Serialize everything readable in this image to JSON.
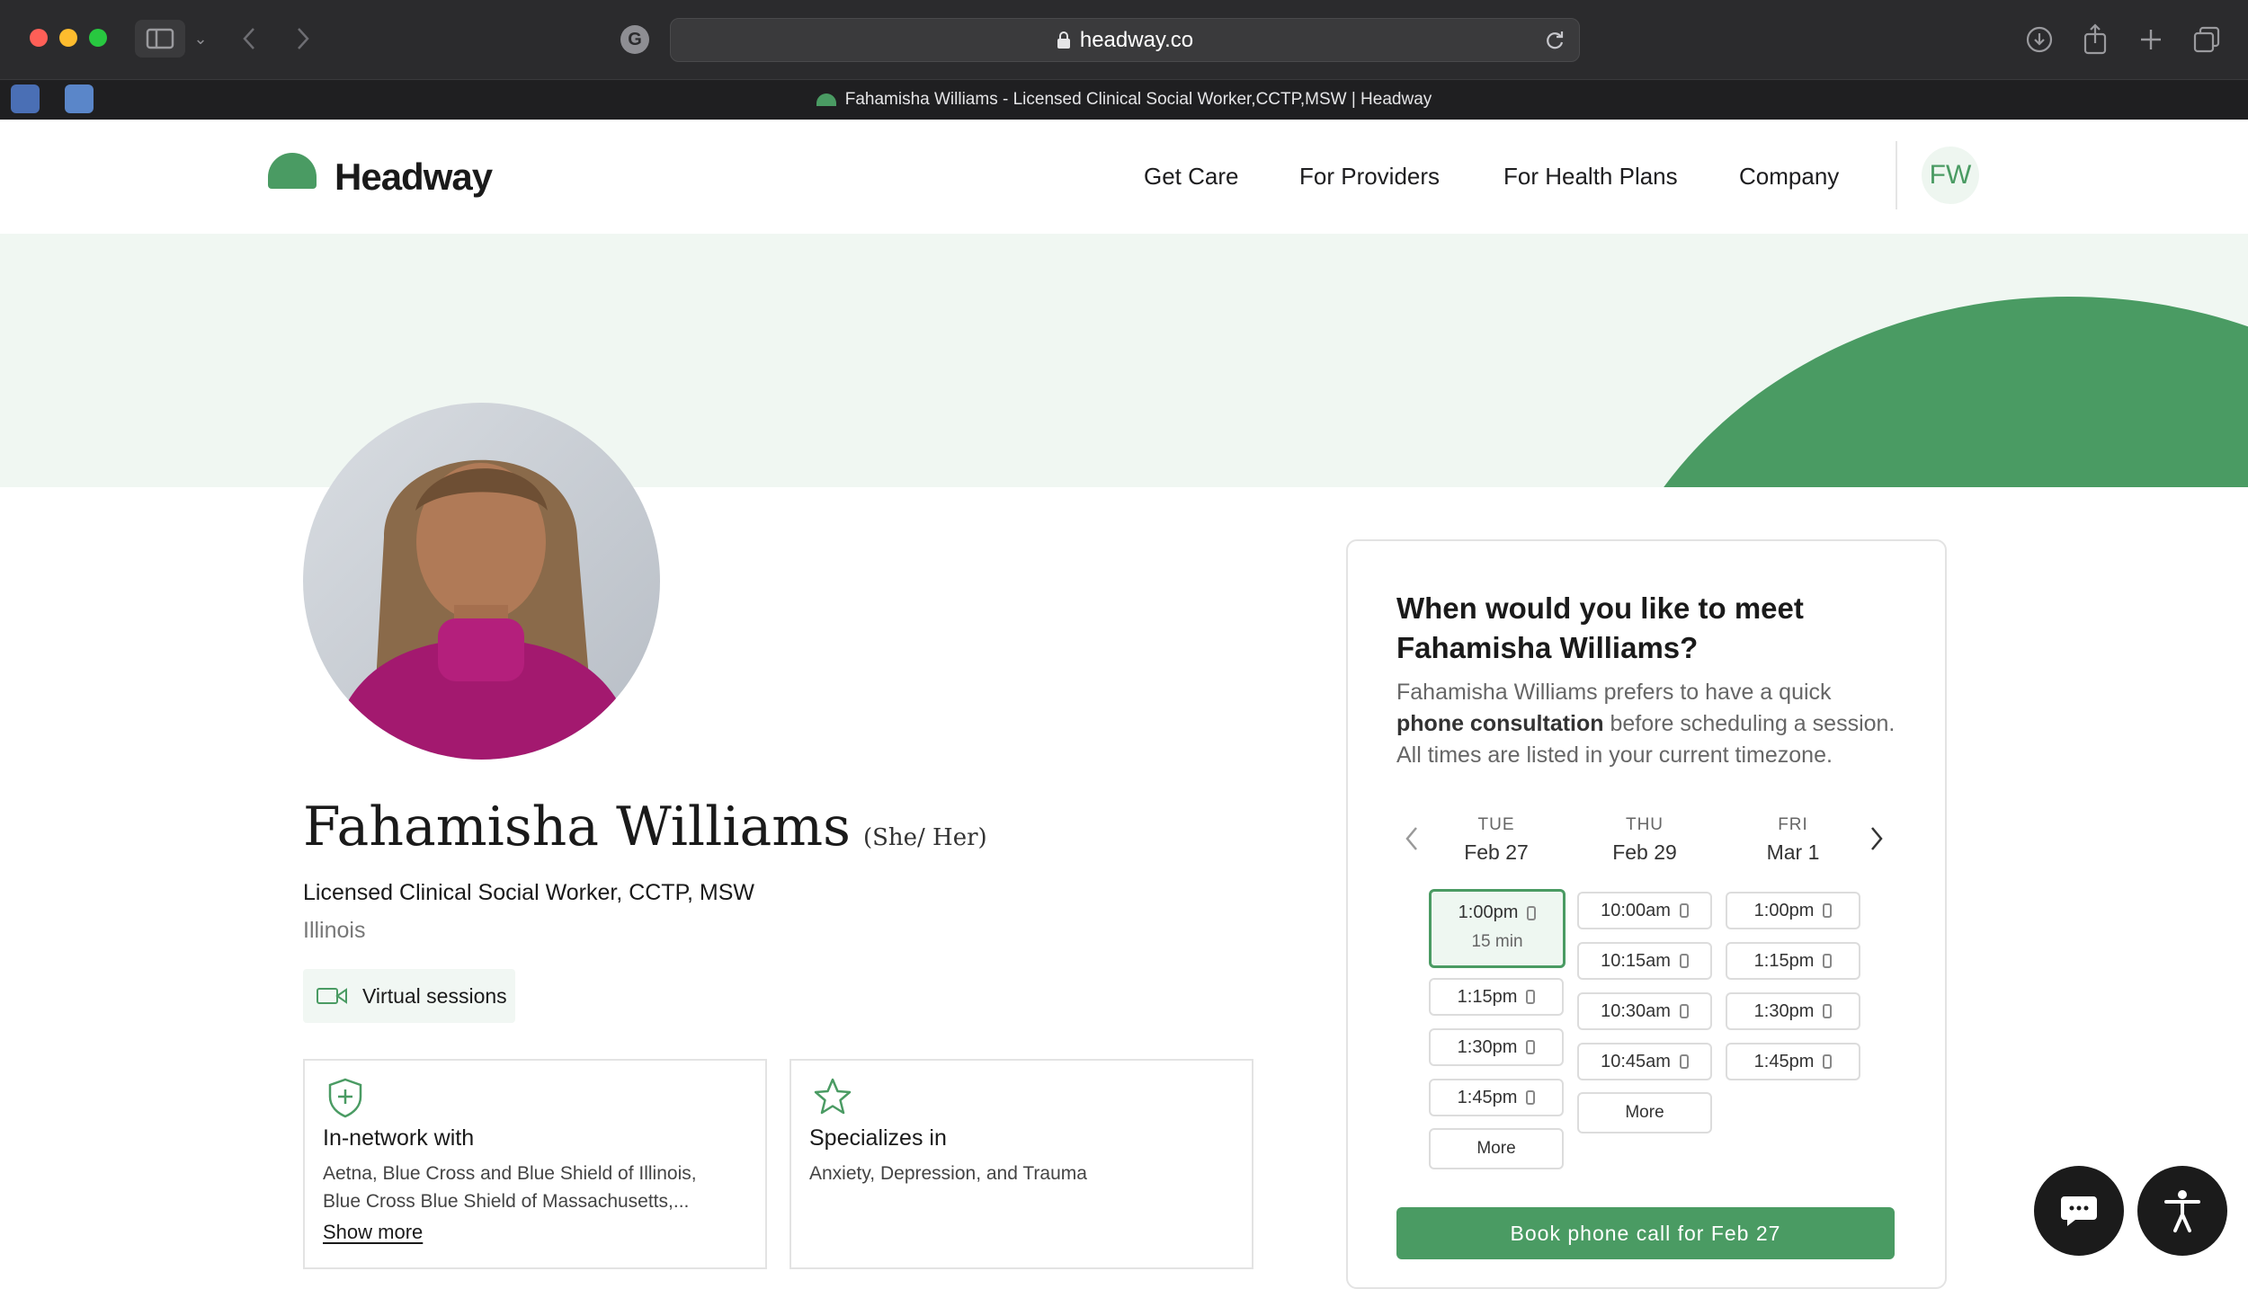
{
  "browser": {
    "url": "headway.co",
    "tab_title": "Fahamisha Williams - Licensed Clinical Social Worker,CCTP,MSW | Headway"
  },
  "site": {
    "logo_text": "Headway",
    "nav": [
      "Get Care",
      "For Providers",
      "For Health Plans",
      "Company"
    ],
    "user_initials": "FW",
    "brand_color": "#4a9b63"
  },
  "profile": {
    "name": "Fahamisha Williams",
    "pronouns": "(She/ Her)",
    "credentials": "Licensed Clinical Social Worker, CCTP, MSW",
    "location": "Illinois",
    "virtual_label": "Virtual sessions",
    "network": {
      "title": "In-network with",
      "line1": "Aetna, Blue Cross and Blue Shield of Illinois,",
      "line2": "Blue Cross Blue Shield of Massachusetts,...",
      "show_more": "Show more"
    },
    "specialties": {
      "title": "Specializes in",
      "text": "Anxiety, Depression, and Trauma"
    }
  },
  "booking": {
    "heading_line1": "When would you like to meet",
    "heading_line2": "Fahamisha Williams?",
    "desc_part1": "Fahamisha Williams prefers to have a quick",
    "desc_bold": "phone consultation",
    "desc_part2": "before scheduling a session.",
    "desc_line3": "All times are listed in your current timezone.",
    "days": [
      {
        "dow": "TUE",
        "date": "Feb 27",
        "slots": [
          "1:00pm",
          "1:15pm",
          "1:30pm",
          "1:45pm"
        ],
        "selected_duration": "15 min",
        "more": "More"
      },
      {
        "dow": "THU",
        "date": "Feb 29",
        "slots": [
          "10:00am",
          "10:15am",
          "10:30am",
          "10:45am"
        ],
        "more": "More"
      },
      {
        "dow": "FRI",
        "date": "Mar 1",
        "slots": [
          "1:00pm",
          "1:15pm",
          "1:30pm",
          "1:45pm"
        ]
      }
    ],
    "cta": "Book phone call for Feb 27"
  }
}
